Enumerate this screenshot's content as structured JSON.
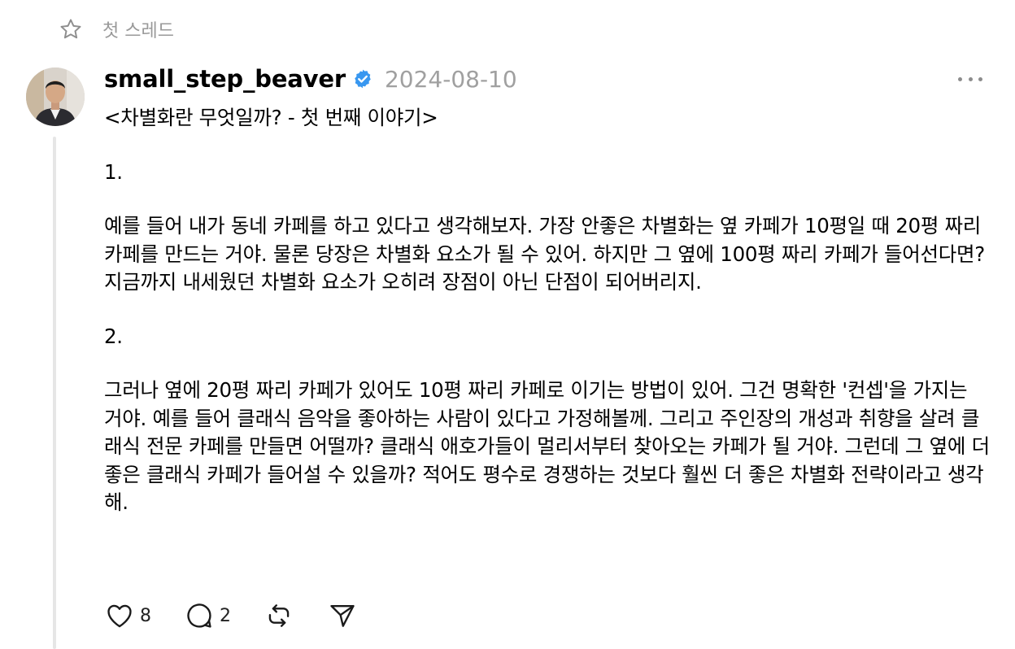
{
  "pinned": {
    "icon": "star-icon",
    "label": "첫 스레드"
  },
  "post": {
    "avatar_icon": "avatar",
    "username": "small_step_beaver",
    "verified": true,
    "verified_color": "#3897f0",
    "date": "2024-08-10",
    "more_icon": "more-dots-icon",
    "title": "<차별화란 무엇일까? - 첫 번째 이야기>",
    "section1_number": "1.",
    "section1_text": "예를 들어 내가 동네 카페를 하고 있다고 생각해보자. 가장 안좋은 차별화는 옆 카페가 10평일 때 20평 짜리 카페를 만드는 거야. 물론 당장은 차별화 요소가 될 수 있어. 하지만 그 옆에 100평 짜리 카페가 들어선다면? 지금까지 내세웠던 차별화 요소가 오히려 장점이 아닌 단점이 되어버리지.",
    "section2_number": "2.",
    "section2_text": "그러나 옆에 20평 짜리 카페가 있어도 10평 짜리 카페로 이기는 방법이 있어. 그건 명확한 '컨셉'을 가지는 거야. 예를 들어 클래식 음악을 좋아하는 사람이 있다고 가정해볼께. 그리고 주인장의 개성과 취향을 살려 클래식 전문 카페를 만들면 어떨까? 클래식 애호가들이 멀리서부터 찾아오는 카페가 될 거야. 그런데 그 옆에 더 좋은 클래식 카페가 들어설 수 있을까? 적어도 평수로 경쟁하는 것보다 훨씬 더 좋은 차별화 전략이라고 생각해."
  },
  "actions": {
    "like_icon": "heart-icon",
    "like_count": "8",
    "reply_icon": "comment-icon",
    "reply_count": "2",
    "repost_icon": "repost-icon",
    "share_icon": "send-icon"
  }
}
